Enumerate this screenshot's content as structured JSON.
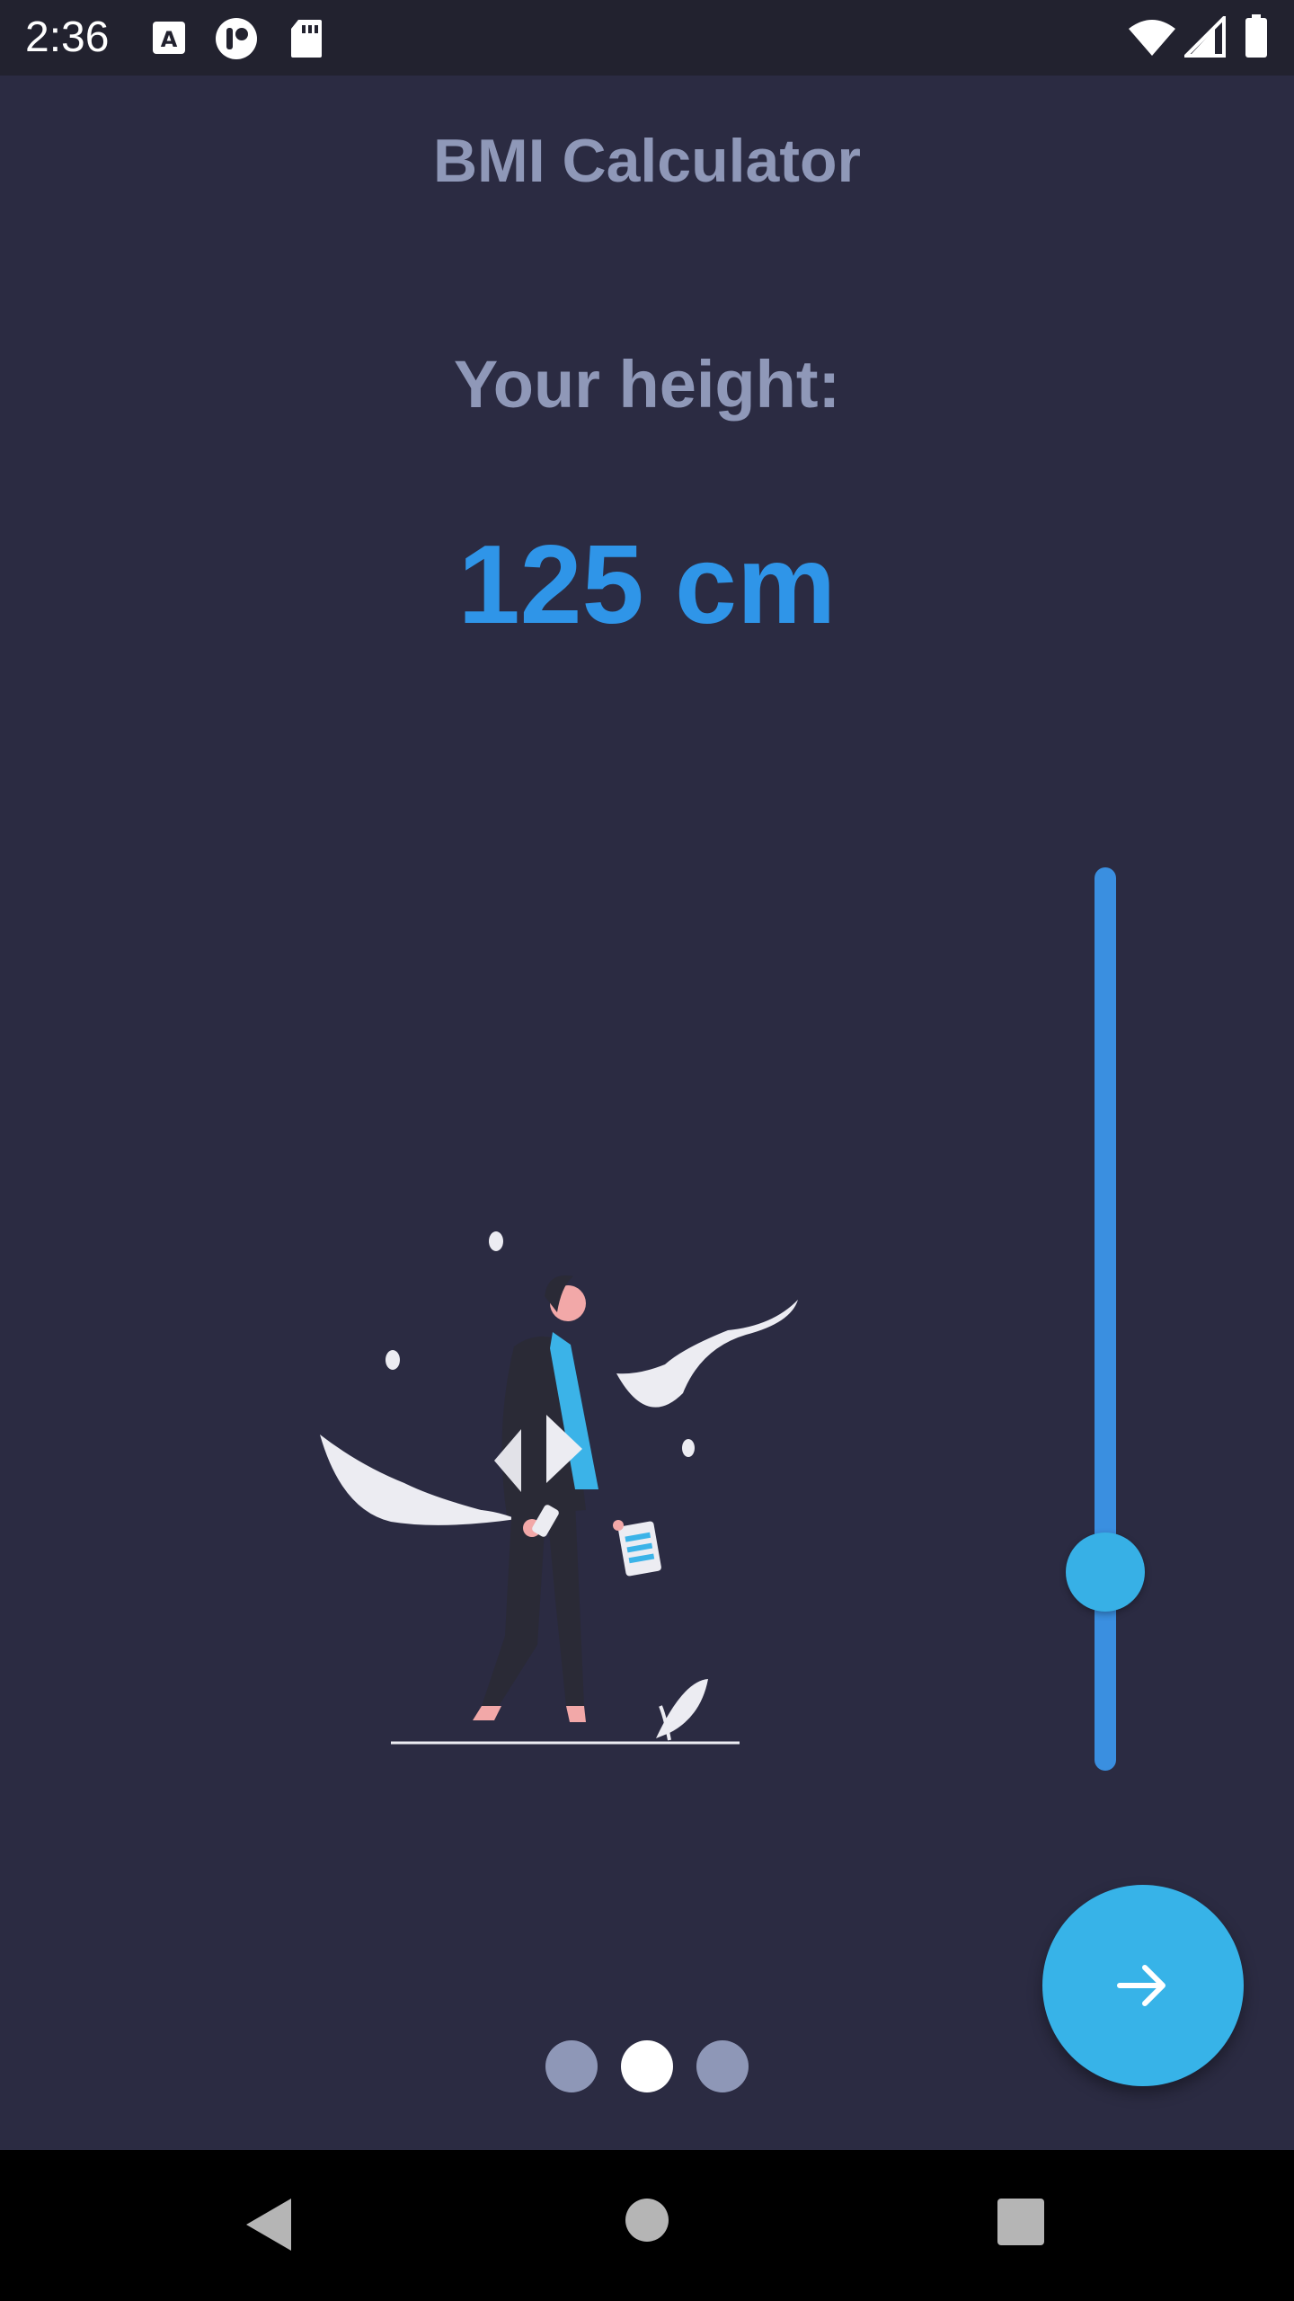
{
  "status_bar": {
    "time": "2:36",
    "icons": [
      "a-keyboard-icon",
      "app-icon",
      "sd-card-icon",
      "wifi-icon",
      "signal-icon",
      "battery-icon"
    ]
  },
  "app": {
    "title": "BMI Calculator",
    "height_label": "Your height:",
    "height_value": "125 cm"
  },
  "slider": {
    "level": 0.22
  },
  "pager": {
    "dots": 3,
    "active_index": 1
  },
  "next_button": {
    "icon": "arrow-right-icon"
  },
  "colors": {
    "background": "#2b2b42",
    "accent": "#2f95e8",
    "label": "#8f98b8",
    "fab": "#37b3e8"
  },
  "nav_bar": {
    "icons": [
      "back-icon",
      "home-icon",
      "recents-icon"
    ]
  }
}
